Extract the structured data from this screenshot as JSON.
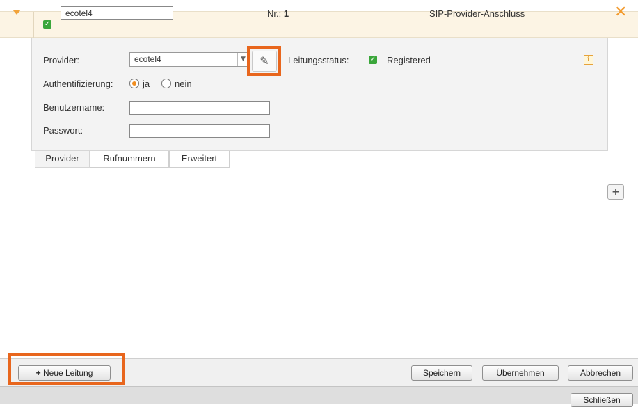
{
  "header": {
    "line_name": "ecotel4",
    "nr_label": "Nr.:",
    "nr_value": "1",
    "type": "SIP-Provider-Anschluss"
  },
  "panel": {
    "provider_label": "Provider:",
    "provider_value": "ecotel4",
    "status_label": "Leitungsstatus:",
    "status_value": "Registered",
    "auth_label": "Authentifizierung:",
    "auth_yes": "ja",
    "auth_no": "nein",
    "username_label": "Benutzername:",
    "password_label": "Passwort:",
    "info_glyph": "i"
  },
  "tabs": [
    {
      "label": "Provider"
    },
    {
      "label": "Rufnummern"
    },
    {
      "label": "Erweitert"
    }
  ],
  "toolbar": {
    "new_line": "Neue Leitung",
    "save": "Speichern",
    "apply": "Übernehmen",
    "cancel": "Abbrechen"
  },
  "statusbar": {
    "close": "Schließen"
  },
  "colors": {
    "accent": "#f39b2e",
    "highlight": "#e8661d",
    "check": "#3aa63a",
    "header_bg": "#fcf4e4"
  }
}
